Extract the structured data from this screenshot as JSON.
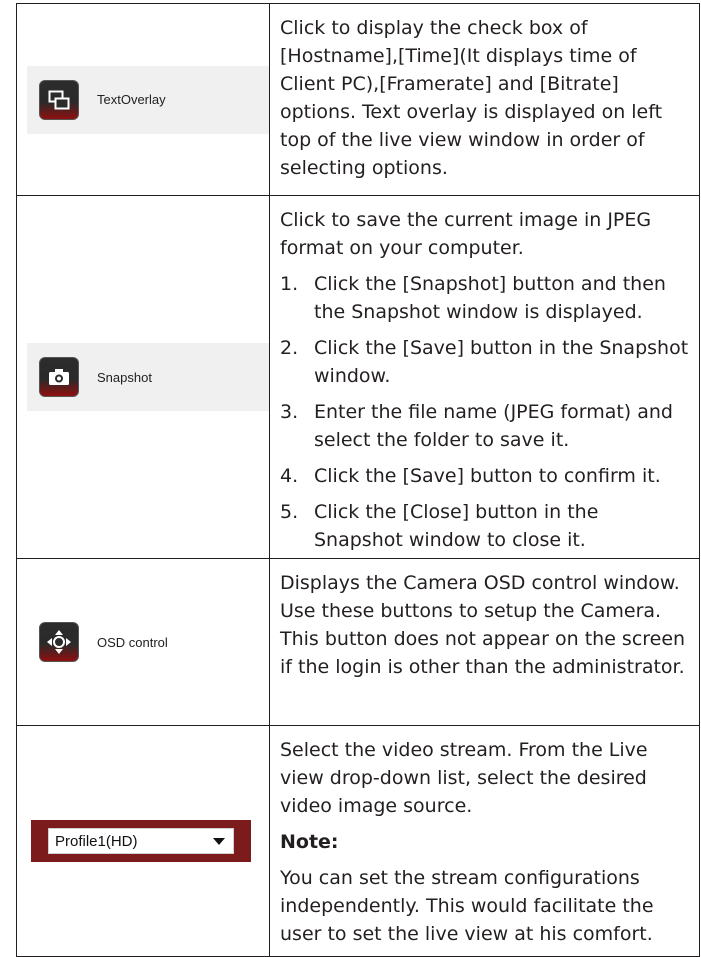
{
  "rows": [
    {
      "button_label": "TextOverlay",
      "icon": "overlay-icon",
      "description": "Click to display the check box of [Hostname],[Time](It displays time of Client PC),[Framerate] and [Bitrate] options. Text overlay is displayed on left top of the live view window in order of selecting options."
    },
    {
      "button_label": "Snapshot",
      "icon": "camera-icon",
      "description": "Click to save the current image in JPEG format on your computer.",
      "steps": [
        {
          "num": "1.",
          "text": "Click the [Snapshot] button and then the Snapshot window is displayed."
        },
        {
          "num": "2.",
          "text": "Click the [Save] button in the Snapshot window."
        },
        {
          "num": "3.",
          "text": "Enter the file name (JPEG format) and select the folder to save it."
        },
        {
          "num": "4.",
          "text": "Click the [Save] button to confirm it."
        },
        {
          "num": "5.",
          "text": "Click the [Close] button in the Snapshot window to close it."
        }
      ]
    },
    {
      "button_label": "OSD control",
      "icon": "osd-control-icon",
      "description": "Displays the Camera OSD control window. Use these buttons to setup the Camera. This button does not appear on the screen if the login is other than the administrator."
    },
    {
      "select_value": "Profile1(HD)",
      "description": "Select the video stream. From the Live view drop-down list, select the desired video image source.",
      "note_title": "Note:",
      "note_text": "You can set the stream configurations independently. This would facilitate the user to set the live view at his comfort."
    }
  ],
  "colors": {
    "icon_red": "#8e0f0f",
    "select_bg": "#7b1b1b",
    "text": "#231f20"
  }
}
